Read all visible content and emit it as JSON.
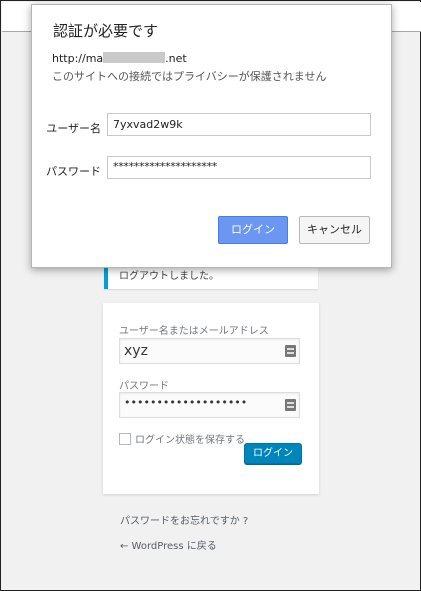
{
  "wp": {
    "message": "ログアウトしました。",
    "username_label": "ユーザー名またはメールアドレス",
    "username_value": "xyz",
    "password_label": "パスワード",
    "password_value": "•••••••••••••••••••",
    "remember_label": "ログイン状態を保存する",
    "login_button": "ログイン",
    "lost_password": "パスワードをお忘れですか ?",
    "back_link": "← WordPress に戻る"
  },
  "dialog": {
    "title": "認証が必要です",
    "url_prefix": "http://ma",
    "url_suffix": ".net",
    "note": "このサイトへの接続ではプライバシーが保護されません",
    "username_label": "ユーザー名",
    "username_value": "7yxvad2w9k",
    "password_label": "パスワード",
    "password_value": "********************",
    "login_button": "ログイン",
    "cancel_button": "キャンセル"
  }
}
